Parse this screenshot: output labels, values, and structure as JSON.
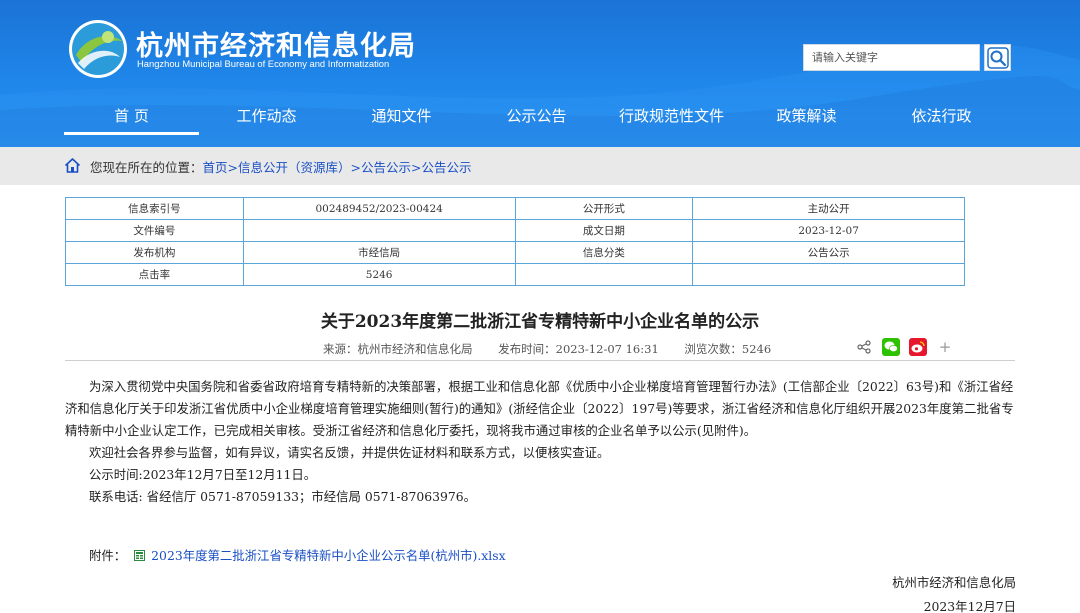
{
  "header": {
    "site_name_cn": "杭州市经济和信息化局",
    "site_name_en": "Hangzhou Municipal Bureau of Economy and Informatization",
    "search_placeholder": "请输入关键字",
    "nav": [
      "首  页",
      "工作动态",
      "通知文件",
      "公示公告",
      "行政规范性文件",
      "政策解读",
      "依法行政"
    ],
    "nav_active_index": 0,
    "colors": {
      "header_bg": "#1f86ea",
      "link": "#1a4fc4",
      "table_border": "#5aa6d8"
    }
  },
  "breadcrumb": {
    "prefix": "您现在所在的位置：",
    "items": [
      "首页",
      "信息公开（资源库）",
      "公告公示",
      "公告公示"
    ],
    "separator": ">"
  },
  "info_table": {
    "rows": [
      [
        "信息索引号",
        "002489452/2023-00424",
        "公开形式",
        "主动公开"
      ],
      [
        "文件编号",
        "",
        "成文日期",
        "2023-12-07"
      ],
      [
        "发布机构",
        "市经信局",
        "信息分类",
        "公告公示"
      ],
      [
        "点击率",
        "5246",
        "",
        ""
      ]
    ]
  },
  "article": {
    "title": "关于2023年度第二批浙江省专精特新中小企业名单的公示",
    "source": "来源：杭州市经济和信息化局",
    "publish_time": "发布时间：2023-12-07 16:31",
    "views": "浏览次数：5246",
    "paragraphs": [
      "为深入贯彻党中央国务院和省委省政府培育专精特新的决策部署，根据工业和信息化部《优质中小企业梯度培育管理暂行办法》(工信部企业〔2022〕63号)和《浙江省经济和信息化厅关于印发浙江省优质中小企业梯度培育管理实施细则(暂行)的通知》(浙经信企业〔2022〕197号)等要求，浙江省经济和信息化厅组织开展2023年度第二批省专精特新中小企业认定工作，已完成相关审核。受浙江省经济和信息化厅委托，现将我市通过审核的企业名单予以公示(见附件)。",
      "欢迎社会各界参与监督，如有异议，请实名反馈，并提供佐证材料和联系方式，以便核实查证。"
    ],
    "notice_time": "公示时间:2023年12月7日至12月11日。",
    "contact": "联系电话: 省经信厅 0571-87059133；市经信局 0571-87063976。",
    "attachment_label": "附件：",
    "attachment_file": "2023年度第二批浙江省专精特新中小企业公示名单(杭州市).xlsx",
    "signature_org": "杭州市经济和信息化局",
    "signature_date": "2023年12月7日"
  },
  "share_icons": [
    "share-icon",
    "wechat-icon",
    "weibo-icon",
    "plus-icon"
  ],
  "share_plus": "+"
}
